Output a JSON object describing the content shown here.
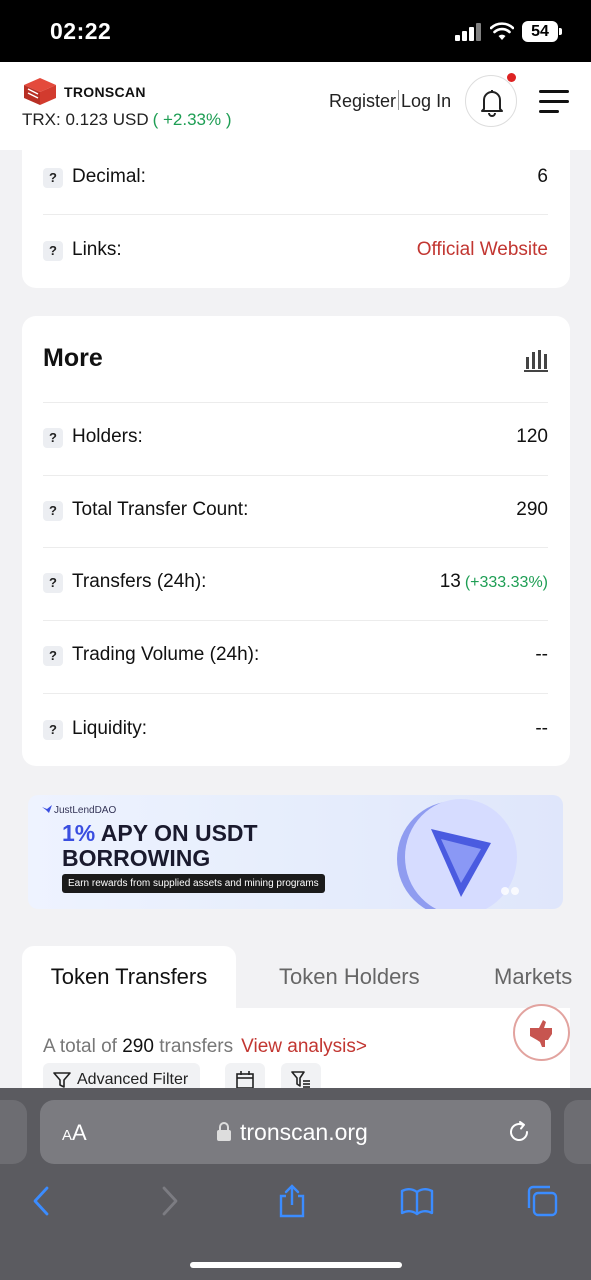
{
  "status_bar": {
    "time": "02:22",
    "battery": "54"
  },
  "header": {
    "logo_text": "TRONSCAN",
    "trx_label": "TRX: 0.123 USD",
    "trx_change": "( +2.33% )",
    "register": "Register",
    "login": "Log In"
  },
  "info_card": {
    "rows": [
      {
        "q": "?",
        "label": "Decimal:",
        "value": "6"
      },
      {
        "q": "?",
        "label": "Links:",
        "value": "Official Website"
      }
    ]
  },
  "more_card": {
    "title": "More",
    "rows": [
      {
        "q": "?",
        "label": "Holders:",
        "value": "120"
      },
      {
        "q": "?",
        "label": "Total Transfer Count:",
        "value": "290"
      },
      {
        "q": "?",
        "label": "Transfers (24h):",
        "value": "13",
        "change": "(+333.33%)"
      },
      {
        "q": "?",
        "label": "Trading Volume (24h):",
        "value": "--"
      },
      {
        "q": "?",
        "label": "Liquidity:",
        "value": "--"
      }
    ]
  },
  "banner": {
    "brand": "JustLendDAO",
    "headline_pct": "1%",
    "headline_1": "APY ON USDT",
    "headline_2": "BORROWING",
    "subtext": "Earn rewards from supplied assets and mining programs"
  },
  "tabs": [
    {
      "label": "Token Transfers",
      "active": true
    },
    {
      "label": "Token Holders",
      "active": false
    },
    {
      "label": "Markets",
      "active": false
    }
  ],
  "transfers": {
    "total_prefix": "A total of",
    "total_count": "290",
    "total_suffix": "transfers",
    "view_analysis": "View analysis>",
    "advanced_filter": "Advanced Filter"
  },
  "safari": {
    "aa_label": "AA",
    "url": "tronscan.org"
  },
  "colors": {
    "accent_red": "#c23631",
    "positive_green": "#1e9e54"
  }
}
